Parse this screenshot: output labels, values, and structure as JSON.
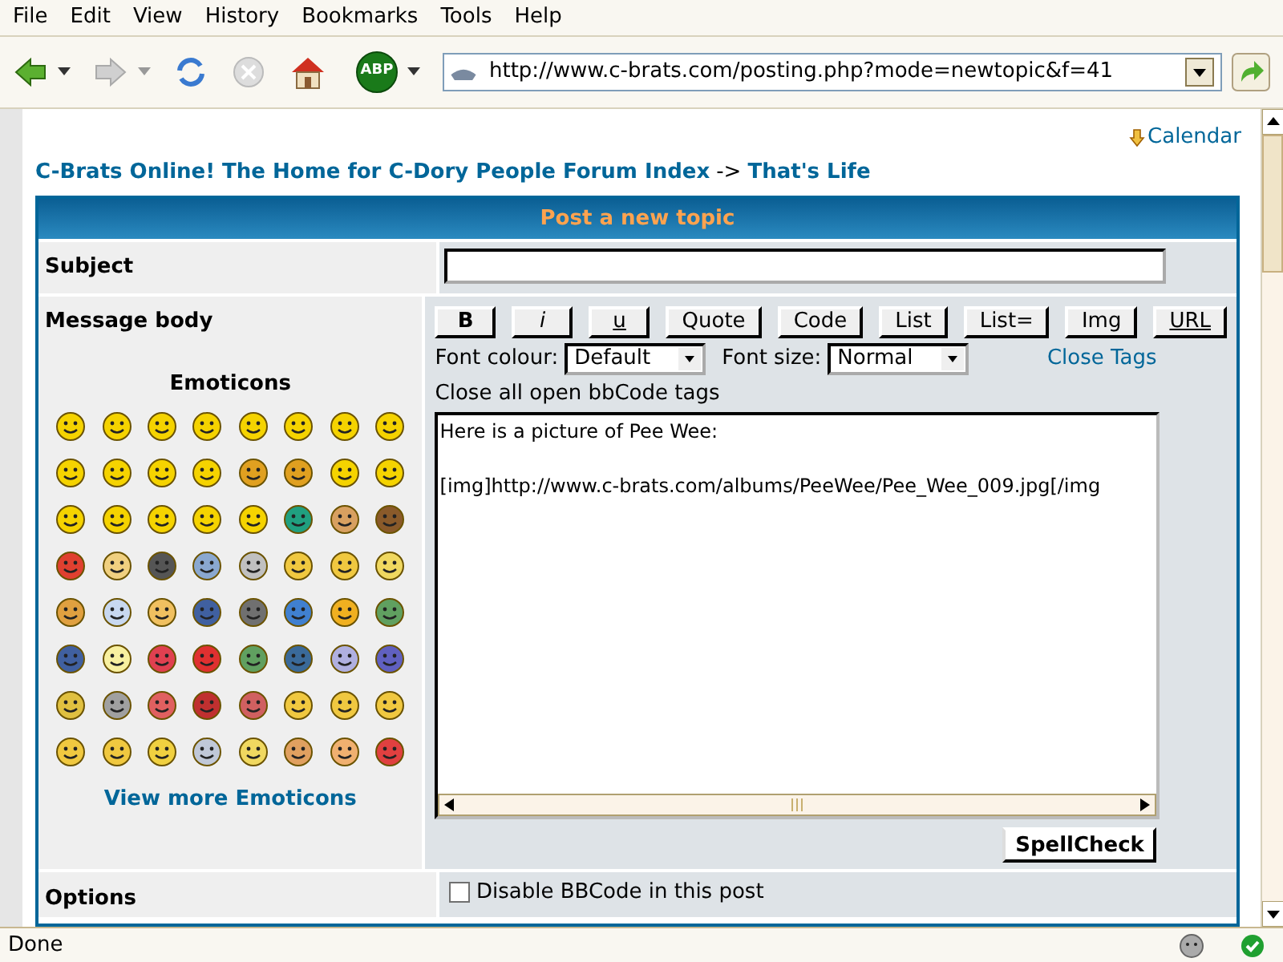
{
  "menu": [
    "File",
    "Edit",
    "View",
    "History",
    "Bookmarks",
    "Tools",
    "Help"
  ],
  "toolbar": {
    "adblock_label": "ABP",
    "address": "http://www.c-brats.com/posting.php?mode=newtopic&f=41"
  },
  "page": {
    "calendar_link": "Calendar",
    "breadcrumb": {
      "index": "C-Brats Online! The Home for C-Dory People Forum Index",
      "separator": "->",
      "forum": "That's Life"
    }
  },
  "form": {
    "title": "Post a new topic",
    "subject_label": "Subject",
    "message_label": "Message body",
    "emoticons_title": "Emoticons",
    "view_more": "View more Emoticons",
    "bbcode_buttons": [
      {
        "label": "B",
        "kind": "bold"
      },
      {
        "label": "i",
        "kind": "italic"
      },
      {
        "label": "u",
        "kind": "underline"
      },
      {
        "label": "Quote",
        "kind": "plain"
      },
      {
        "label": "Code",
        "kind": "plain"
      },
      {
        "label": "List",
        "kind": "plain"
      },
      {
        "label": "List=",
        "kind": "plain"
      },
      {
        "label": "Img",
        "kind": "plain"
      },
      {
        "label": "URL",
        "kind": "underline"
      }
    ],
    "font_colour": {
      "label": "Font colour:",
      "value": "Default"
    },
    "font_size": {
      "label": "Font size:",
      "value": "Normal"
    },
    "close_tags": "Close Tags",
    "help_text": "Close all open bbCode tags",
    "message": "Here is a picture of Pee Wee:\n\n[img]http://www.c-brats.com/albums/PeeWee/Pee_Wee_009.jpg[/img",
    "spellcheck": "SpellCheck",
    "options_label": "Options",
    "options": [
      {
        "label": "Disable BBCode in this post",
        "checked": false
      }
    ]
  },
  "status_bar": {
    "text": "Done"
  }
}
